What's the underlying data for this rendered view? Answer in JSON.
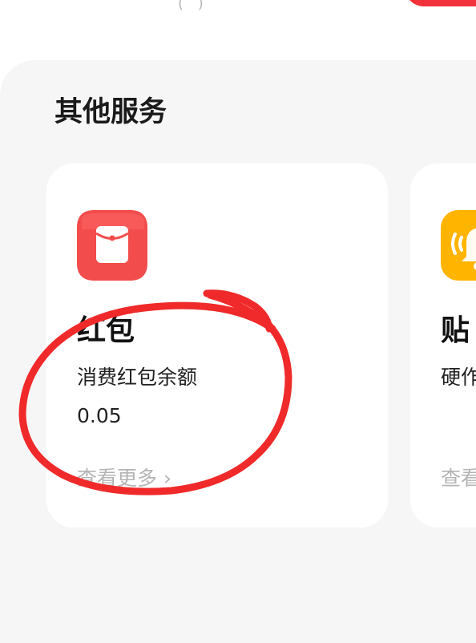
{
  "header": {
    "partial_text": "( )"
  },
  "section": {
    "title": "其他服务"
  },
  "cards": [
    {
      "title": "红包",
      "subtitle": "消费红包余额",
      "value": "0.05",
      "more_label": "查看更多",
      "icon": "red-envelope-icon",
      "icon_color": "#f24c4c"
    },
    {
      "title": "贴",
      "subtitle": "硬作",
      "more_label": "查看",
      "icon": "bell-icon",
      "icon_color": "#ffb400"
    }
  ],
  "colors": {
    "accent_red": "#f2323a",
    "panel_bg": "#f6f6f6",
    "annotation": "#f02a2a"
  }
}
